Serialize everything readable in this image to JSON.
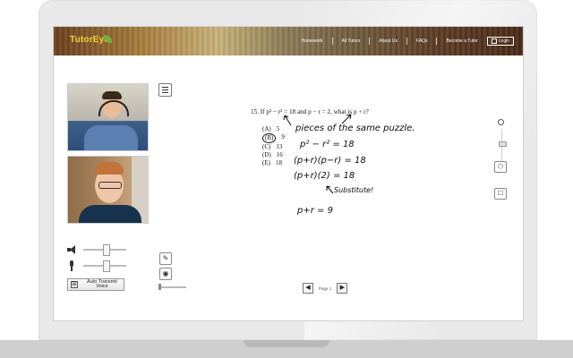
{
  "app": {
    "logo": "TutorEye",
    "nav": [
      "Homework",
      "All Tutors",
      "About Us",
      "FAQs",
      "Become a Tutor"
    ],
    "login": "Login"
  },
  "icons": {
    "menu": "menu-icon",
    "speaker": "speaker-icon",
    "mic": "mic-icon",
    "pencil": "pencil-icon",
    "palette": "palette-icon",
    "zoom": "zoom-icon",
    "shape": "shape-icon",
    "chat": "chat-icon",
    "prev": "prev-page-icon",
    "next": "next-page-icon"
  },
  "audio": {
    "auto_transmit": "Auto Transmit Voice",
    "checkbox": "☒"
  },
  "problem": {
    "text": "15.  If p² − r² = 18 and p − r = 2, what is p + r?",
    "choices": [
      {
        "label": "(A)",
        "value": "5"
      },
      {
        "label": "(B)",
        "value": "9"
      },
      {
        "label": "(C)",
        "value": "13"
      },
      {
        "label": "(D)",
        "value": "16"
      },
      {
        "label": "(E)",
        "value": "18"
      }
    ]
  },
  "handwriting": {
    "line1": "pieces of the same puzzle.",
    "line2": "p² − r² = 18",
    "line3": "(p+r)(p−r) = 18",
    "line4": "(p+r)(2) = 18",
    "line5": "Substitute!",
    "line6": "p+r = 9"
  },
  "pager": {
    "label": "Page 1",
    "prev": "◀",
    "next": "▶"
  },
  "tools": {
    "pencil": "✎",
    "palette": "🎨",
    "chat": "☐"
  }
}
